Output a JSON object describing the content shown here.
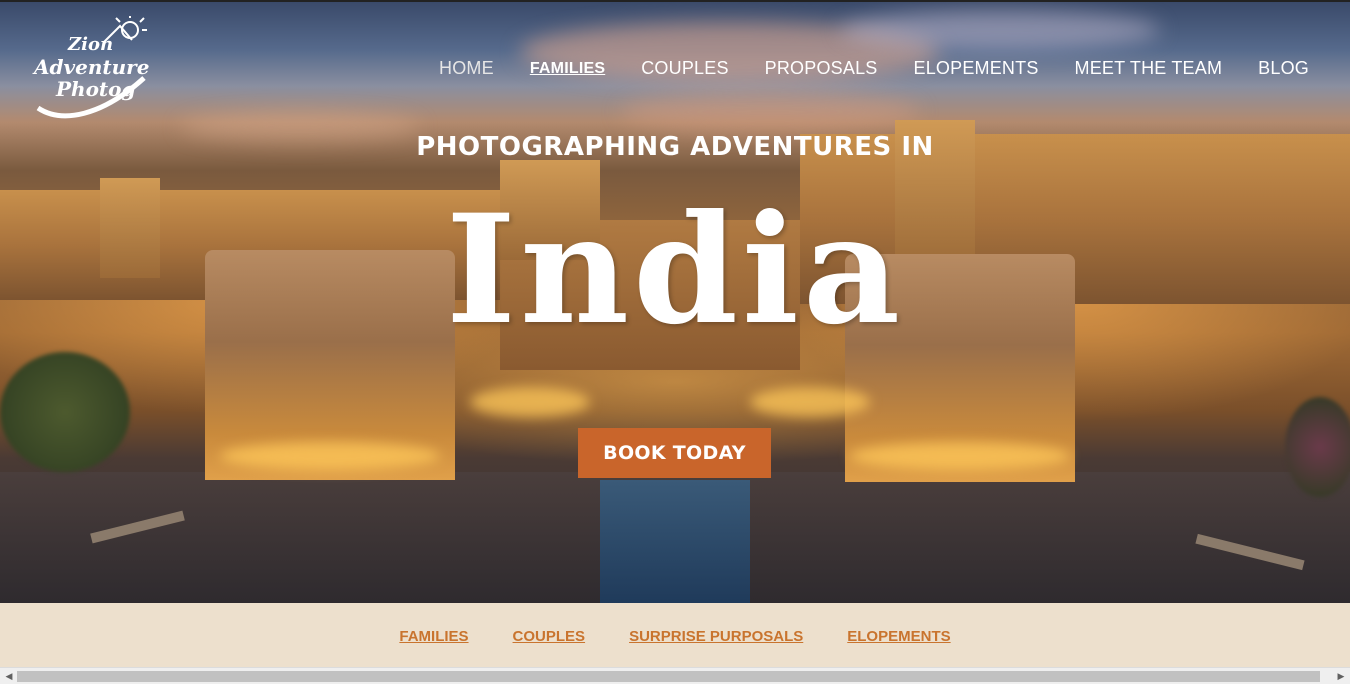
{
  "brand": {
    "logo_text_line1": "Zion",
    "logo_text_line2": "Adventure",
    "logo_text_line3": "Photog"
  },
  "nav": {
    "items": [
      {
        "label": "HOME"
      },
      {
        "label": "FAMILIES",
        "active": true
      },
      {
        "label": "COUPLES"
      },
      {
        "label": "PROPOSALS"
      },
      {
        "label": "ELOPEMENTS"
      },
      {
        "label": "MEET THE TEAM"
      },
      {
        "label": "BLOG"
      }
    ]
  },
  "hero": {
    "kicker": "PHOTOGRAPHING ADVENTURES IN",
    "headline": "India",
    "cta_label": "BOOK TODAY"
  },
  "subnav": {
    "links": [
      {
        "label": "FAMILIES"
      },
      {
        "label": "COUPLES"
      },
      {
        "label": "SURPRISE PURPOSALS"
      },
      {
        "label": "ELOPEMENTS"
      }
    ]
  },
  "colors": {
    "accent": "#c9652b",
    "subbar_bg": "#ede0cd",
    "subnav_link": "#c9742e"
  }
}
